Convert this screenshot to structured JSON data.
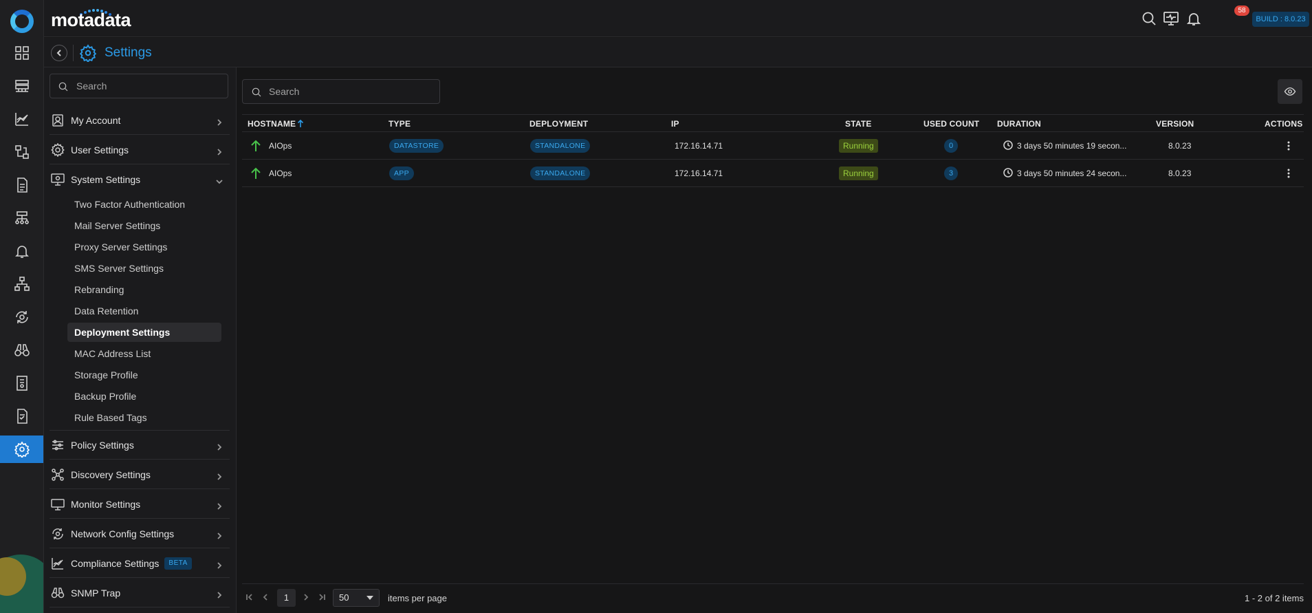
{
  "app": {
    "brand": "motadata",
    "build_label": "BUILD : 8.0.23",
    "notification_count": "58"
  },
  "header": {
    "title": "Settings"
  },
  "sidebar": {
    "search_placeholder": "Search",
    "groups": [
      {
        "label": "My Account",
        "icon": "user-badge-icon"
      },
      {
        "label": "User Settings",
        "icon": "user-gear-icon"
      },
      {
        "label": "System Settings",
        "icon": "monitor-gear-icon",
        "expanded": true
      },
      {
        "label": "Policy Settings",
        "icon": "sliders-icon"
      },
      {
        "label": "Discovery Settings",
        "icon": "discovery-icon"
      },
      {
        "label": "Monitor Settings",
        "icon": "monitor-icon"
      },
      {
        "label": "Network Config Settings",
        "icon": "network-config-icon"
      },
      {
        "label": "Compliance Settings",
        "icon": "compliance-icon",
        "badge": "BETA"
      },
      {
        "label": "SNMP Trap",
        "icon": "binoculars-icon"
      }
    ],
    "system_settings_items": [
      "Two Factor Authentication",
      "Mail Server Settings",
      "Proxy Server Settings",
      "SMS Server Settings",
      "Rebranding",
      "Data Retention",
      "Deployment Settings",
      "MAC Address List",
      "Storage Profile",
      "Backup Profile",
      "Rule Based Tags"
    ],
    "active_item": "Deployment Settings"
  },
  "main": {
    "search_placeholder": "Search",
    "columns": [
      "HOSTNAME",
      "TYPE",
      "DEPLOYMENT",
      "IP",
      "STATE",
      "USED COUNT",
      "DURATION",
      "VERSION",
      "ACTIONS"
    ],
    "sort": {
      "column": "HOSTNAME",
      "direction": "ascending"
    },
    "rows": [
      {
        "hostname": "AIOps",
        "type": "DATASTORE",
        "deployment": "STANDALONE",
        "ip": "172.16.14.71",
        "state": "Running",
        "used_count": "0",
        "duration": "3 days 50 minutes 19 secon...",
        "version": "8.0.23"
      },
      {
        "hostname": "AIOps",
        "type": "APP",
        "deployment": "STANDALONE",
        "ip": "172.16.14.71",
        "state": "Running",
        "used_count": "3",
        "duration": "3 days 50 minutes 24 secon...",
        "version": "8.0.23"
      }
    ]
  },
  "pager": {
    "current_page": "1",
    "page_size": "50",
    "items_per_page_label": "items per page",
    "summary": "1 - 2 of 2 items"
  },
  "colors": {
    "accent": "#2b9ae6",
    "running_bg": "#3d4a17",
    "running_fg": "#9bd13d",
    "status_up": "#48c24a"
  }
}
